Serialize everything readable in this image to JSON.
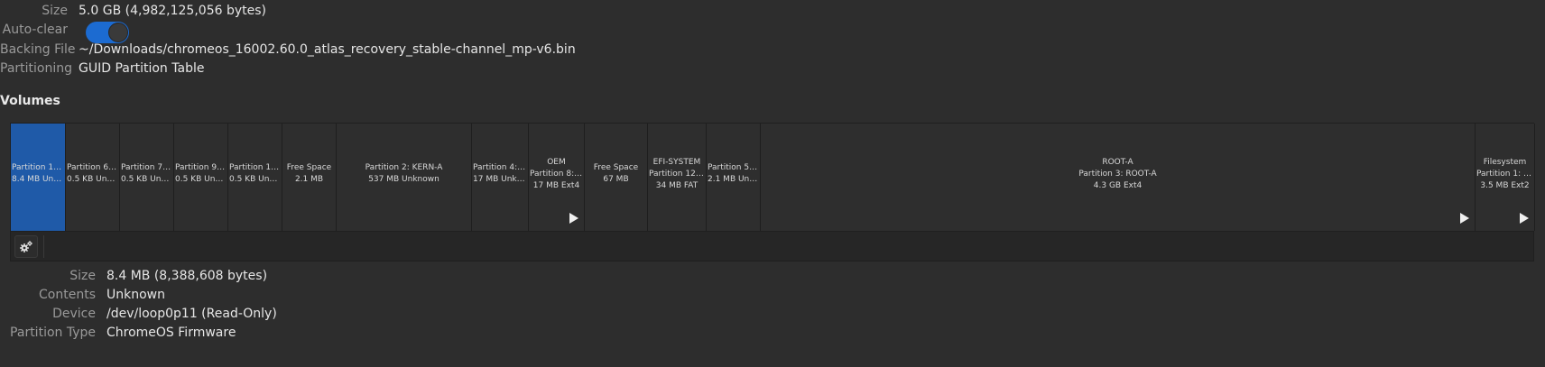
{
  "drive": {
    "size_label": "Size",
    "size_value": "5.0 GB (4,982,125,056 bytes)",
    "autoclear_label": "Auto-clear",
    "autoclear_on": true,
    "backing_label": "Backing File",
    "backing_value": "~/Downloads/chromeos_16002.60.0_atlas_recovery_stable-channel_mp-v6.bin",
    "partitioning_label": "Partitioning",
    "partitioning_value": "GUID Partition Table"
  },
  "volumes_heading": "Volumes",
  "volumes": [
    {
      "lines": [
        "Partition 11: …",
        "8.4 MB Unkn…"
      ],
      "selected": true
    },
    {
      "lines": [
        "Partition 6: …",
        "0.5 KB Unkn…"
      ]
    },
    {
      "lines": [
        "Partition 7: …",
        "0.5 KB Unkn…"
      ]
    },
    {
      "lines": [
        "Partition 9: r…",
        "0.5 KB Unkn…"
      ]
    },
    {
      "lines": [
        "Partition 10: …",
        "0.5 KB Unkn…"
      ]
    },
    {
      "lines": [
        "Free Space",
        "2.1 MB"
      ]
    },
    {
      "lines": [
        "Partition 2: KERN-A",
        "537 MB Unknown"
      ]
    },
    {
      "lines": [
        "Partition 4: K…",
        "17 MB Unkn…"
      ]
    },
    {
      "lines": [
        "OEM",
        "Partition 8: O…",
        "17 MB Ext4"
      ],
      "play": true
    },
    {
      "lines": [
        "Free Space",
        "67 MB"
      ]
    },
    {
      "lines": [
        "EFI-SYSTEM",
        "Partition 12: E…",
        "34 MB FAT"
      ]
    },
    {
      "lines": [
        "Partition 5: …",
        "2.1 MB Unk…"
      ]
    },
    {
      "lines": [
        "ROOT-A",
        "Partition 3: ROOT-A",
        "4.3 GB Ext4"
      ],
      "play": true
    },
    {
      "lines": [
        "Filesystem",
        "Partition 1: ST…",
        "3.5 MB Ext2"
      ],
      "play": true
    }
  ],
  "toolbar": {
    "settings_icon": "gears-icon"
  },
  "details": {
    "size_label": "Size",
    "size_value": "8.4 MB (8,388,608 bytes)",
    "contents_label": "Contents",
    "contents_value": "Unknown",
    "device_label": "Device",
    "device_value": "/dev/loop0p11 (Read-Only)",
    "ptype_label": "Partition Type",
    "ptype_value": "ChromeOS Firmware"
  },
  "colors": {
    "accent": "#1c6bd1",
    "selected_volume": "#1f5aa8",
    "background": "#2d2d2d"
  }
}
